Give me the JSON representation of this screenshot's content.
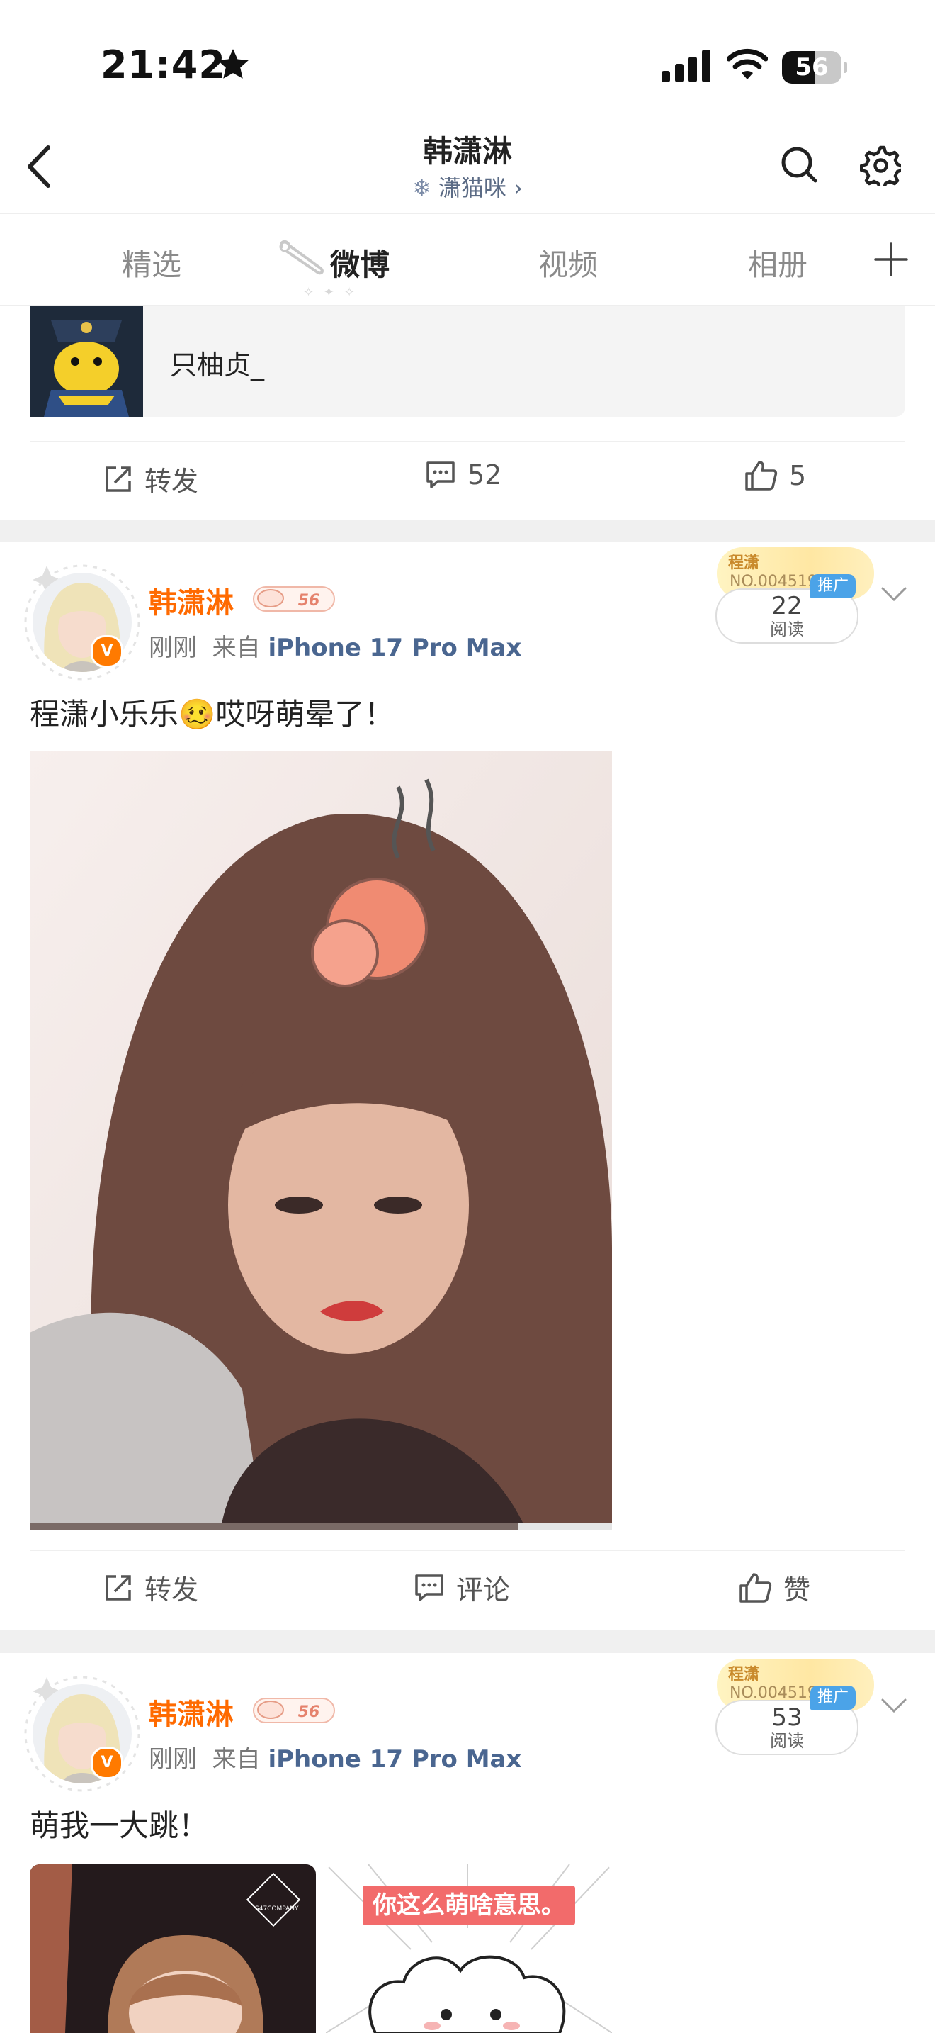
{
  "status_bar": {
    "time": "21:42",
    "battery_level": "56",
    "battery_fraction": 0.56,
    "icons": [
      "star-icon",
      "signal-icon",
      "wifi-icon",
      "battery-icon"
    ]
  },
  "header": {
    "title": "韩潇淋",
    "subtitle": "潇猫咪",
    "subtitle_chevron": "›",
    "subtitle_icon": "snowflake-icon"
  },
  "tabs": [
    {
      "label": "精选"
    },
    {
      "label": "微博",
      "active": true
    },
    {
      "label": "视频"
    },
    {
      "label": "相册"
    }
  ],
  "tab_decoration": "✧ ✦ ✧",
  "repost_card": {
    "name": "只柚贞_"
  },
  "post0_actions": {
    "repost": "转发",
    "comments": "52",
    "likes": "5"
  },
  "posts": [
    {
      "username": "韩潇淋",
      "fan_badge": "56",
      "time": "刚刚",
      "source_prefix": "来自",
      "source": "iPhone 17 Pro Max",
      "reads": "22",
      "reads_label": "阅读",
      "promo_label": "推广",
      "card_title": "程潇",
      "card_no": "NO.004519",
      "text_before": "程潇小乐乐",
      "emoji": "🥴",
      "text_after": "哎呀萌晕了！",
      "video_progress": 0.84,
      "actions": {
        "repost": "转发",
        "comment": "评论",
        "like": "赞"
      }
    },
    {
      "username": "韩潇淋",
      "fan_badge": "56",
      "time": "刚刚",
      "source_prefix": "来自",
      "source": "iPhone 17 Pro Max",
      "reads": "53",
      "reads_label": "阅读",
      "promo_label": "推广",
      "card_title": "程潇",
      "card_no": "NO.004519",
      "text": "萌我一大跳！",
      "image2_text": "你这么萌啥意思。",
      "logo_text": "S47COMPANY"
    }
  ],
  "colors": {
    "accent_orange": "#ff6a00",
    "source_blue": "#4a6690",
    "promo_blue": "#4ba3e8",
    "gap_gray": "#f0f0f0"
  }
}
